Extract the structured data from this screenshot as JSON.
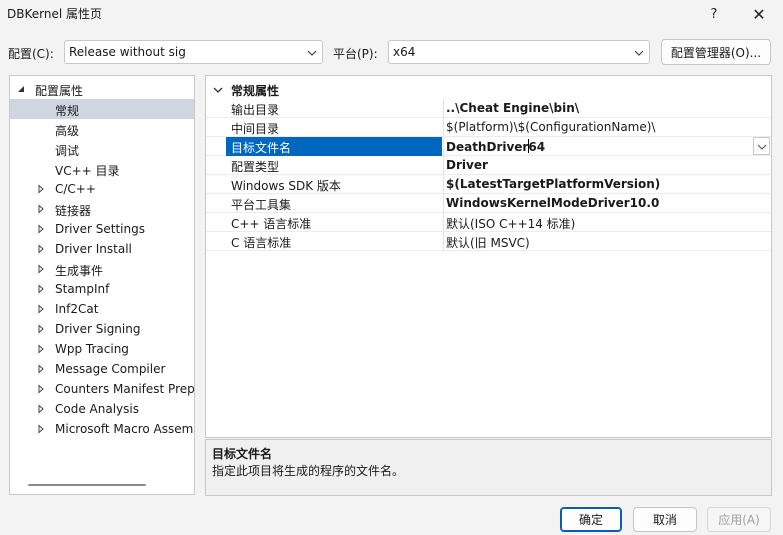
{
  "window": {
    "title": "DBKernel 属性页",
    "help_glyph": "?",
    "close_glyph": "✕"
  },
  "toolbar": {
    "config_label": "配置(C):",
    "config_value": "Release without sig",
    "platform_label": "平台(P):",
    "platform_value": "x64",
    "config_manager_label": "配置管理器(O)..."
  },
  "tree": {
    "items": [
      {
        "label": "配置属性",
        "state": "expanded"
      },
      {
        "label": "常规",
        "selected": true
      },
      {
        "label": "高级"
      },
      {
        "label": "调试"
      },
      {
        "label": "VC++ 目录"
      },
      {
        "label": "C/C++",
        "state": "collapsed"
      },
      {
        "label": "链接器",
        "state": "collapsed"
      },
      {
        "label": "Driver Settings",
        "state": "collapsed"
      },
      {
        "label": "Driver Install",
        "state": "collapsed"
      },
      {
        "label": "生成事件",
        "state": "collapsed"
      },
      {
        "label": "StampInf",
        "state": "collapsed"
      },
      {
        "label": "Inf2Cat",
        "state": "collapsed"
      },
      {
        "label": "Driver Signing",
        "state": "collapsed"
      },
      {
        "label": "Wpp Tracing",
        "state": "collapsed"
      },
      {
        "label": "Message Compiler",
        "state": "collapsed"
      },
      {
        "label": "Counters Manifest Prepr",
        "state": "collapsed"
      },
      {
        "label": "Code Analysis",
        "state": "collapsed"
      },
      {
        "label": "Microsoft Macro Assem",
        "state": "collapsed"
      }
    ]
  },
  "grid": {
    "category": "常规属性",
    "rows": [
      {
        "name": "输出目录",
        "value": "..\\Cheat Engine\\bin\\",
        "bold": true
      },
      {
        "name": "中间目录",
        "value": "$(Platform)\\$(ConfigurationName)\\",
        "bold": false
      },
      {
        "name": "目标文件名",
        "value_before_cursor": "DeathDriver",
        "value_after_cursor": "64",
        "bold": true,
        "selected": true
      },
      {
        "name": "配置类型",
        "value": "Driver",
        "bold": true
      },
      {
        "name": "Windows SDK 版本",
        "value": "$(LatestTargetPlatformVersion)",
        "bold": true
      },
      {
        "name": "平台工具集",
        "value": "WindowsKernelModeDriver10.0",
        "bold": true
      },
      {
        "name": "C++ 语言标准",
        "value": "默认(ISO C++14 标准)",
        "bold": false
      },
      {
        "name": "C 语言标准",
        "value": "默认(旧 MSVC)",
        "bold": false
      }
    ]
  },
  "description": {
    "title": "目标文件名",
    "text": "指定此项目将生成的程序的文件名。"
  },
  "buttons": {
    "ok": "确定",
    "cancel": "取消",
    "apply": "应用(A)"
  },
  "colors": {
    "selection": "#0067c0",
    "tree_selection": "#cfd6e0",
    "primary_border": "#0a5cb5"
  }
}
